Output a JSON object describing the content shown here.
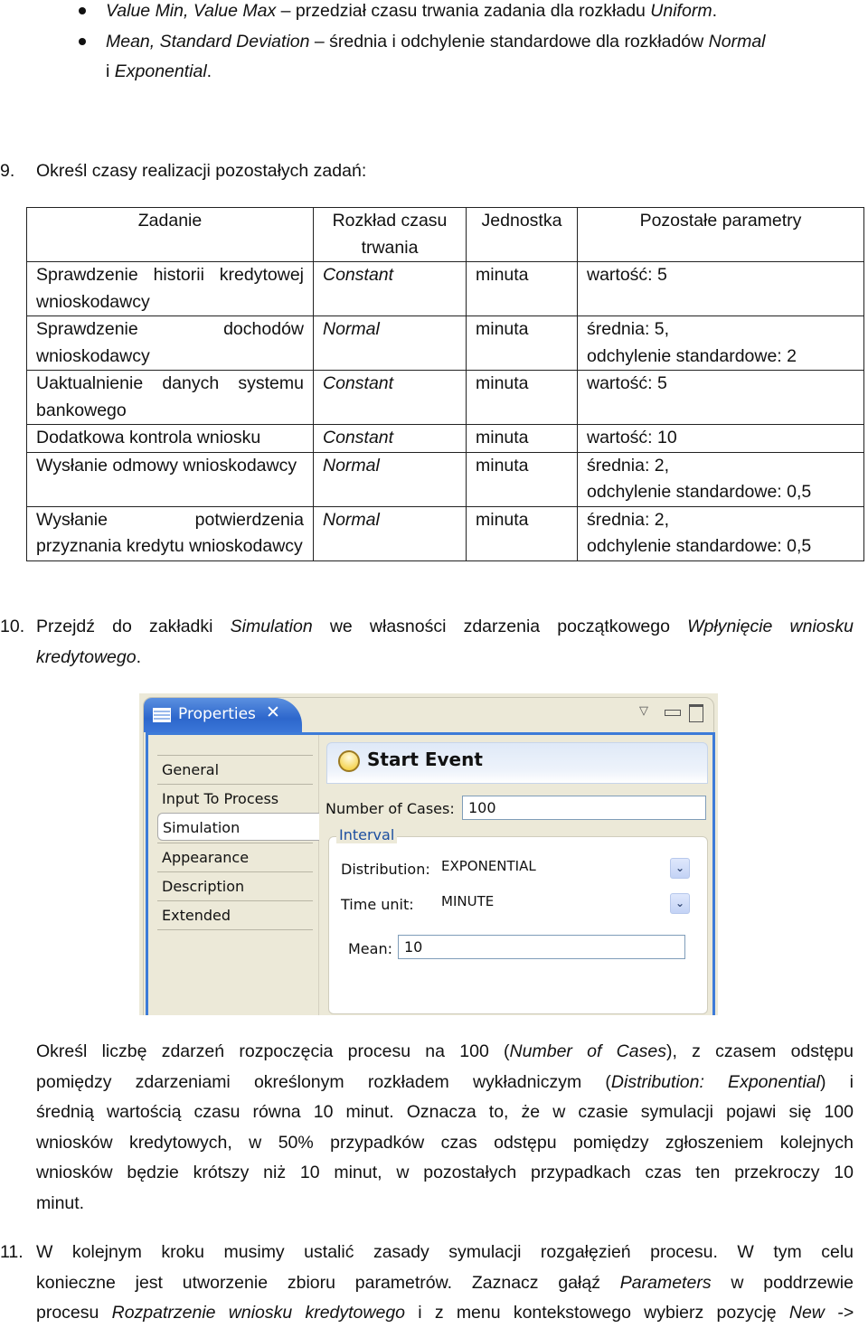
{
  "bullets": [
    {
      "italic_lead": "Value Min, Value Max",
      "text": " – przedział czasu trwania zadania dla rozkładu ",
      "italic_tail": "Uniform",
      "end": "."
    },
    {
      "italic_lead": "Mean, Standard Deviation",
      "text": " – średnia i odchylenie standardowe dla rozkładów ",
      "italic_tail": "Normal",
      "end": "",
      "line2_pre": "i ",
      "line2_italic": "Exponential",
      "line2_end": "."
    }
  ],
  "step9": {
    "number": "9.",
    "text": "Określ czasy realizacji pozostałych zadań:"
  },
  "table": {
    "headers": [
      "Zadanie",
      "Rozkład czasu trwania",
      "Jednostka",
      "Pozostałe parametry"
    ],
    "rows": [
      {
        "task": "Sprawdzenie historii kredytowej wnioskodawcy",
        "distribution": "Constant",
        "unit": "minuta",
        "params": [
          "wartość: 5"
        ]
      },
      {
        "task": "Sprawdzenie dochodów wnioskodawcy",
        "distribution": "Normal",
        "unit": "minuta",
        "params": [
          "średnia: 5,",
          "odchylenie standardowe: 2"
        ]
      },
      {
        "task": "Uaktualnienie danych systemu bankowego",
        "distribution": "Constant",
        "unit": "minuta",
        "params": [
          "wartość: 5"
        ]
      },
      {
        "task": "Dodatkowa kontrola wniosku",
        "distribution": "Constant",
        "unit": "minuta",
        "params": [
          "wartość: 10"
        ]
      },
      {
        "task": "Wysłanie odmowy wnioskodawcy",
        "distribution": "Normal",
        "unit": "minuta",
        "params": [
          "średnia: 2,",
          "odchylenie standardowe: 0,5"
        ]
      },
      {
        "task": "Wysłanie potwierdzenia przyznania kredytu wnioskodawcy",
        "distribution": "Normal",
        "unit": "minuta",
        "params": [
          "średnia: 2,",
          "odchylenie standardowe: 0,5"
        ]
      }
    ]
  },
  "step10": {
    "number": "10.",
    "pre": "Przejdź do zakładki ",
    "it1": "Simulation",
    "mid": " we własności zdarzenia początkowego ",
    "it2": "Wpłynięcie wniosku",
    "line2_it": "kredytowego",
    "line2_end": "."
  },
  "properties_panel": {
    "tab_title": "Properties",
    "window_controls": {
      "menu": "▽",
      "minimize": "▭",
      "maximize": "□"
    },
    "sidebar": [
      "General",
      "Input To Process",
      "Simulation",
      "Appearance",
      "Description",
      "Extended"
    ],
    "selected_tab": "Simulation",
    "header_title": "Start Event",
    "number_of_cases_label": "Number of Cases:",
    "number_of_cases_value": "100",
    "interval_group_title": "Interval",
    "distribution_label": "Distribution:",
    "distribution_value": "EXPONENTIAL",
    "time_unit_label": "Time unit:",
    "time_unit_value": "MINUTE",
    "mean_label": "Mean:",
    "mean_value": "10",
    "accent_color": "#3d7bd8"
  },
  "paragraph": [
    [
      "Określ liczbę zdarzeń rozpoczęcia procesu na 100 (",
      {
        "it": "Number of Cases"
      },
      "), z czasem odstępu"
    ],
    [
      "pomiędzy zdarzeniami określonym rozkładem wykładniczym (",
      {
        "it": "Distribution: Exponential"
      },
      ") i"
    ],
    [
      "średnią wartością czasu równa 10 minut. Oznacza to, że w czasie symulacji pojawi się 100"
    ],
    [
      "wniosków kredytowych, w 50% przypadków czas odstępu pomiędzy zgłoszeniem kolejnych"
    ],
    [
      "wniosków będzie krótszy niż 10 minut, w pozostałych przypadkach czas ten przekroczy 10"
    ],
    [
      "minut."
    ]
  ],
  "step11": {
    "number": "11.",
    "lines": [
      [
        "W kolejnym kroku musimy ustalić zasady symulacji rozgałęzień procesu. W tym celu"
      ],
      [
        "konieczne jest utworzenie zbioru parametrów. Zaznacz gałąź ",
        {
          "it": "Parameters"
        },
        " w poddrzewie"
      ],
      [
        "procesu ",
        {
          "it": "Rozpatrzenie wniosku kredytowego"
        },
        " i z menu kontekstowego wybierz pozycję ",
        {
          "it": "New ->"
        }
      ]
    ]
  }
}
